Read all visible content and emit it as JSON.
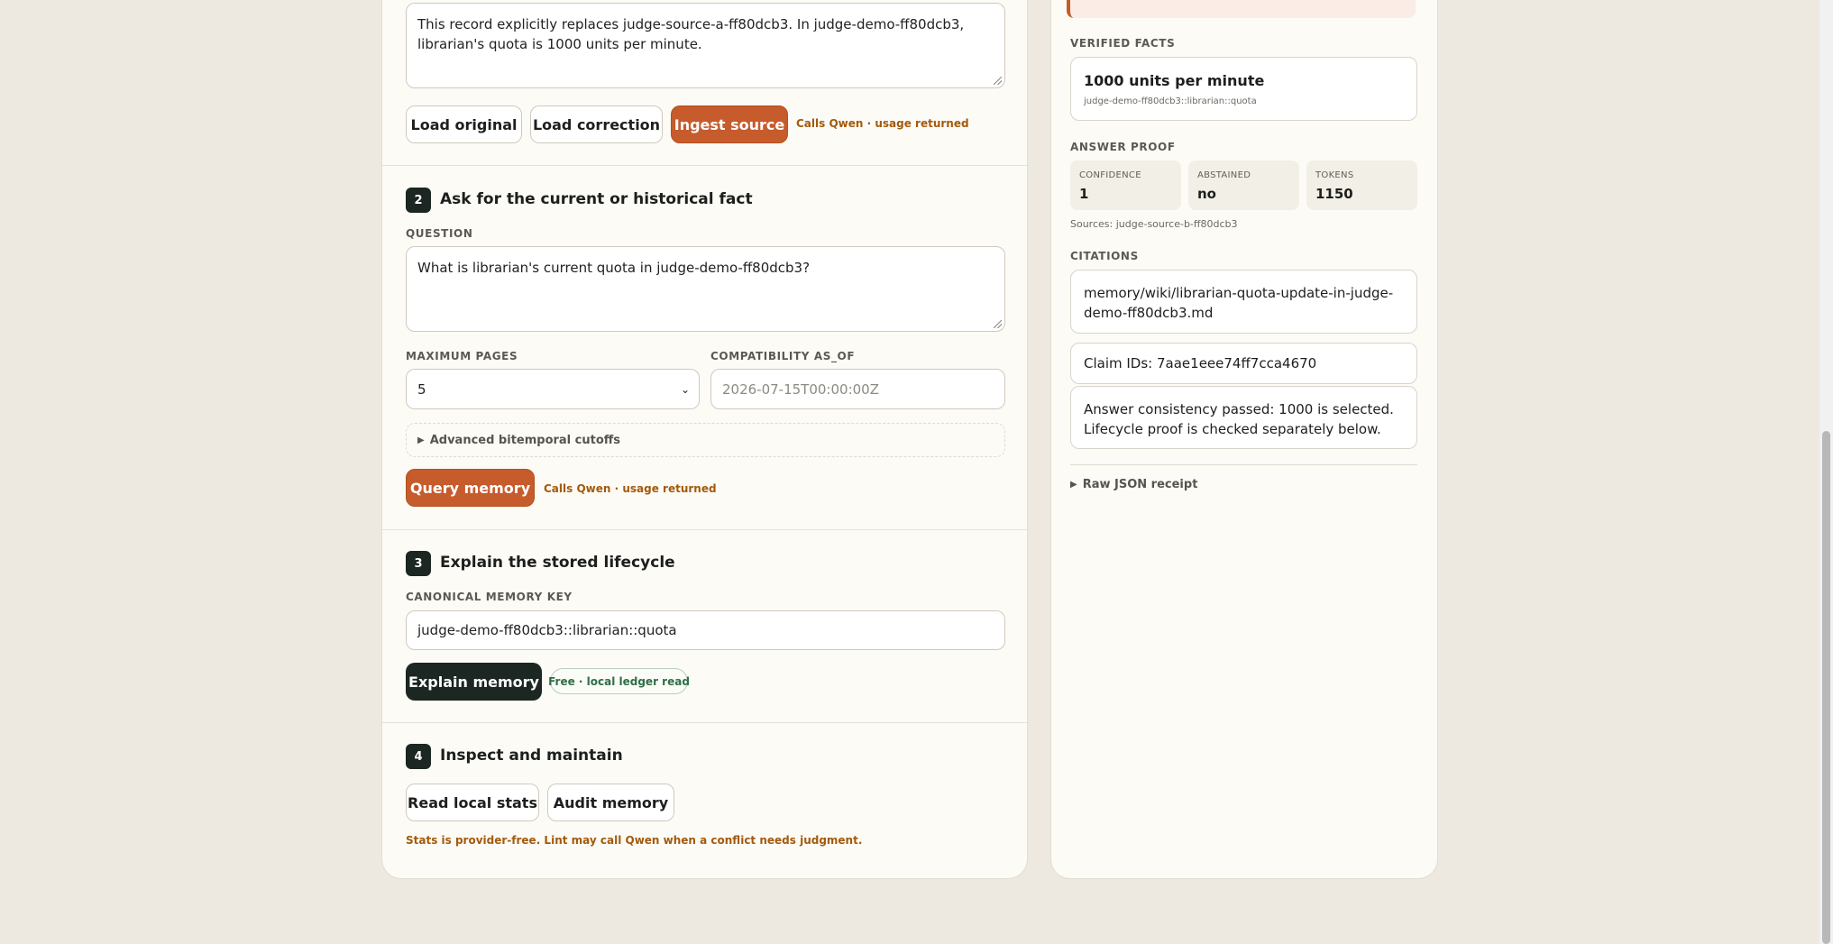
{
  "ingest": {
    "source_text_line1": "This record explicitly replaces judge-source-a-ff80dcb3. In judge-demo-ff80dcb3,",
    "source_text_line2": "librarian's quota is 1000 units per minute.",
    "load_original_label": "Load original",
    "load_correction_label": "Load correction",
    "ingest_label": "Ingest source",
    "ingest_note": "Calls Qwen · usage returned"
  },
  "step2": {
    "number": "2",
    "title": "Ask for the current or historical fact",
    "question_label": "QUESTION",
    "question_value": "What is librarian's current quota in judge-demo-ff80dcb3?",
    "max_pages_label": "MAXIMUM PAGES",
    "max_pages_value": "5",
    "as_of_label": "COMPATIBILITY AS_OF",
    "as_of_placeholder": "2026-07-15T00:00:00Z",
    "advanced_label": "Advanced bitemporal cutoffs",
    "query_label": "Query memory",
    "query_note": "Calls Qwen · usage returned"
  },
  "step3": {
    "number": "3",
    "title": "Explain the stored lifecycle",
    "key_label": "CANONICAL MEMORY KEY",
    "key_value": "judge-demo-ff80dcb3::librarian::quota",
    "explain_label": "Explain memory",
    "explain_note": "Free · local ledger read"
  },
  "step4": {
    "number": "4",
    "title": "Inspect and maintain",
    "stats_label": "Read local stats",
    "audit_label": "Audit memory",
    "note": "Stats is provider-free. Lint may call Qwen when a conflict needs judgment."
  },
  "results": {
    "verified_label": "VERIFIED FACTS",
    "fact_value": "1000 units per minute",
    "fact_key": "judge-demo-ff80dcb3::librarian::quota",
    "proof_label": "ANSWER PROOF",
    "confidence_label": "CONFIDENCE",
    "confidence_value": "1",
    "abstained_label": "ABSTAINED",
    "abstained_value": "no",
    "tokens_label": "TOKENS",
    "tokens_value": "1150",
    "sources_text": "Sources: judge-source-b-ff80dcb3",
    "citations_label": "CITATIONS",
    "citation_path_line1": "memory/wiki/librarian-quota-update-in-judge-",
    "citation_path_line2": "demo-ff80dcb3.md",
    "claim_ids": "Claim IDs: 7aae1eee74ff7cca4670",
    "consistency_line1": "Answer consistency passed: 1000 is selected.",
    "consistency_line2": "Lifecycle proof is checked separately below.",
    "raw_json_label": "Raw JSON receipt"
  },
  "colors": {
    "accent": "#c65b2c",
    "dark": "#1c2622",
    "note_orange": "#a35a0c",
    "note_green": "#2f6e45",
    "background": "#ede9e0",
    "panel": "#fcfbf6"
  },
  "icons": {
    "disclosure": "triangle-right-icon",
    "select": "chevron-down-icon"
  }
}
